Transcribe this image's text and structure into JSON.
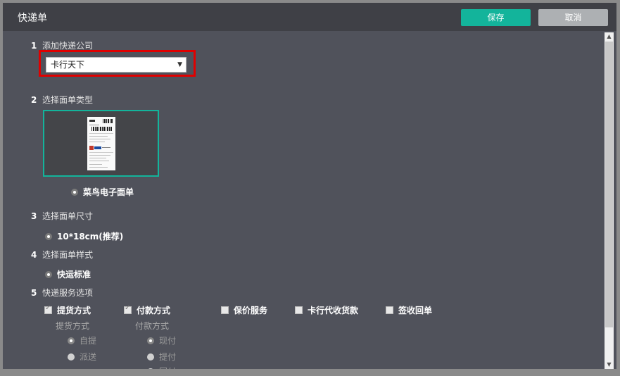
{
  "dialog": {
    "title": "快递单",
    "save_label": "保存",
    "cancel_label": "取消"
  },
  "section1": {
    "num": "1",
    "label": "添加快递公司",
    "selected_company": "卡行天下"
  },
  "section2": {
    "num": "2",
    "label": "选择面单类型",
    "option_label": "菜鸟电子面单"
  },
  "section3": {
    "num": "3",
    "label": "选择面单尺寸",
    "option_label": "10*18cm(推荐)"
  },
  "section4": {
    "num": "4",
    "label": "选择面单样式",
    "option_label": "快运标准"
  },
  "section5": {
    "num": "5",
    "label": "快递服务选项",
    "checks": [
      {
        "label": "提货方式",
        "checked": true
      },
      {
        "label": "付款方式",
        "checked": true
      },
      {
        "label": "保价服务",
        "checked": false
      },
      {
        "label": "卡行代收货款",
        "checked": false
      },
      {
        "label": "签收回单",
        "checked": false
      }
    ],
    "pickup": {
      "title": "提货方式",
      "options": [
        "自提",
        "派送"
      ],
      "selected": "自提"
    },
    "payment": {
      "title": "付款方式",
      "options": [
        "现付",
        "提付",
        "回付"
      ],
      "selected": "现付"
    }
  }
}
